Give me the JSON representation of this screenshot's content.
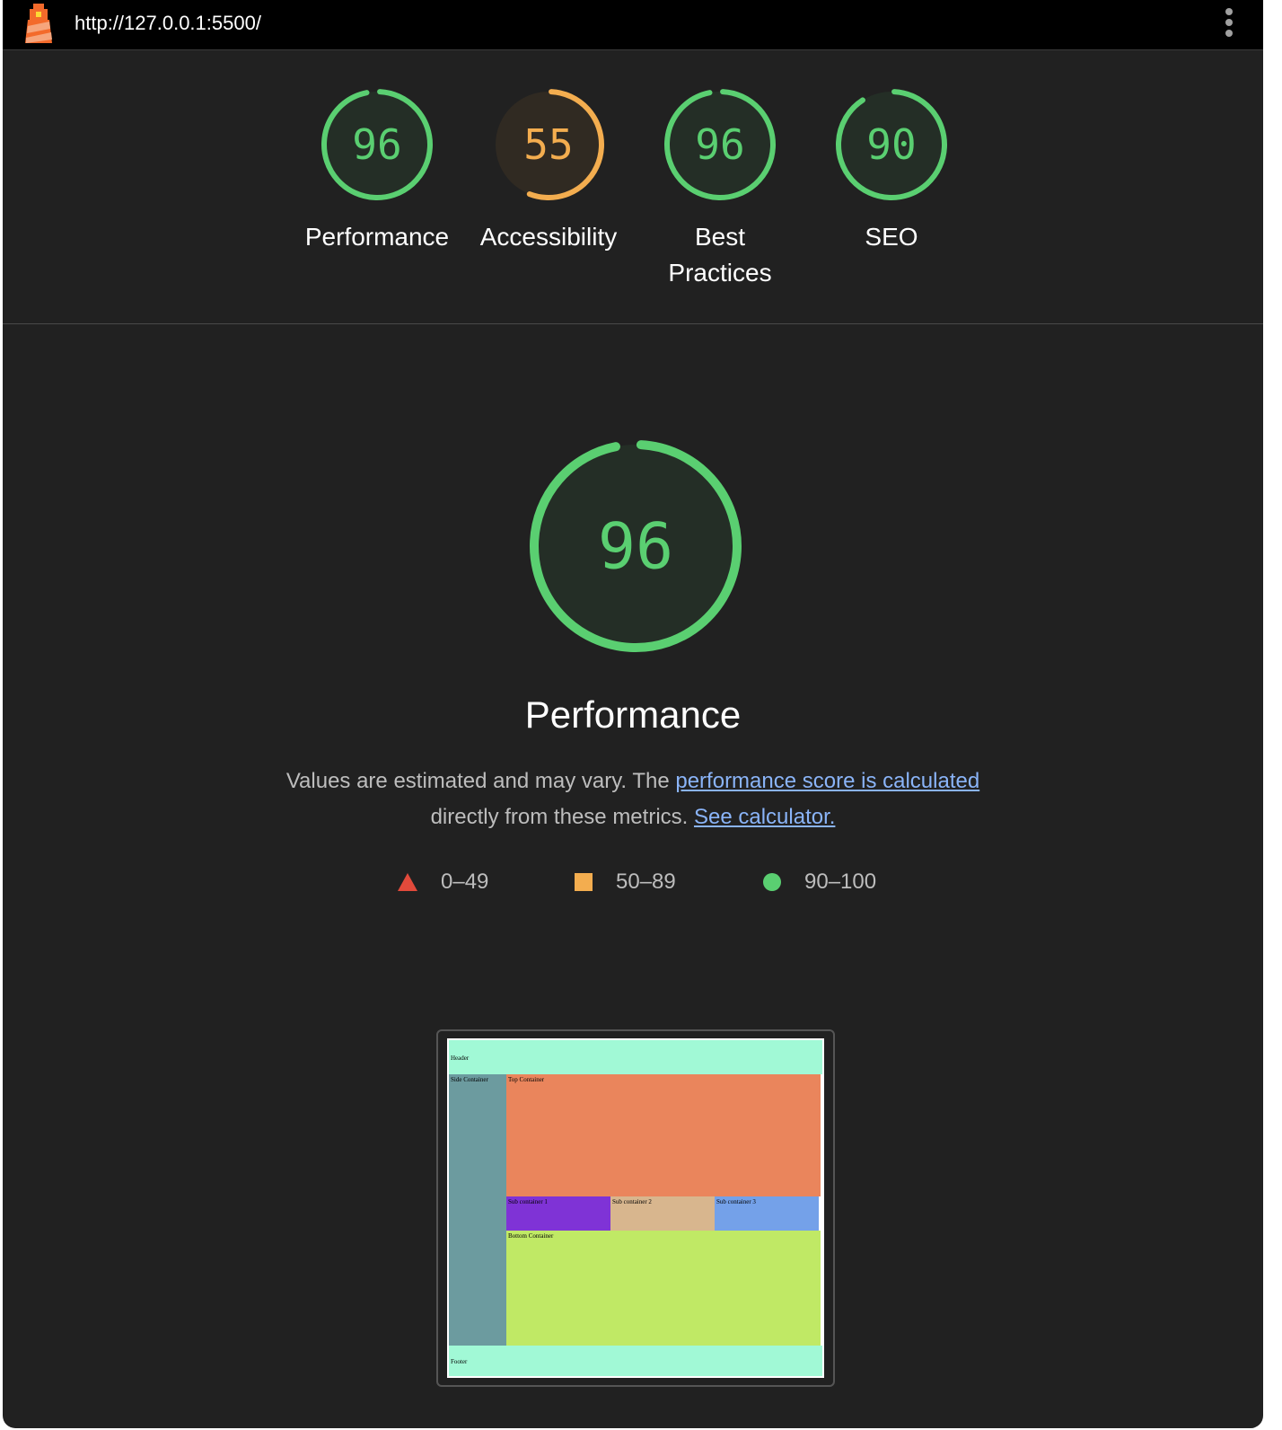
{
  "topbar": {
    "url": "http://127.0.0.1:5500/"
  },
  "categories": [
    {
      "label": "Performance",
      "score": "96",
      "score_value": 96,
      "color": "#5acf71",
      "bg": "#242e26"
    },
    {
      "label": "Accessibility",
      "score": "55",
      "score_value": 55,
      "color": "#f3ad4f",
      "bg": "#302a22"
    },
    {
      "label": "Best Practices",
      "score": "96",
      "score_value": 96,
      "color": "#5acf71",
      "bg": "#242e26"
    },
    {
      "label": "SEO",
      "score": "90",
      "score_value": 90,
      "color": "#5acf71",
      "bg": "#242e26"
    }
  ],
  "performance": {
    "score": "96",
    "score_value": 96,
    "title": "Performance",
    "desc_part1": "Values are estimated and may vary. The ",
    "desc_link1": "performance score is calculated",
    "desc_part2": " directly from these metrics. ",
    "desc_link2": "See calculator."
  },
  "legend": [
    {
      "range": "0–49",
      "icon": "triangle-icon",
      "color": "#e24a3b"
    },
    {
      "range": "50–89",
      "icon": "square-icon",
      "color": "#f3ad4f"
    },
    {
      "range": "90–100",
      "icon": "circle-icon",
      "color": "#5acf71"
    }
  ],
  "screenshot": {
    "header": "Header",
    "side": "Side Container",
    "top": "Top Container",
    "sub1": "Sub container 1",
    "sub2": "Sub container 2",
    "sub3": "Sub container 3",
    "bottom": "Bottom Container",
    "footer": "Footer",
    "colors": {
      "header": "#a1f9d6",
      "side": "#6c9b9f",
      "top": "#ea855c",
      "sub1": "#7f33d6",
      "sub2": "#d8b68e",
      "sub3": "#74a1e9",
      "bottom": "#c0e965",
      "footer": "#a1f9d6"
    }
  }
}
